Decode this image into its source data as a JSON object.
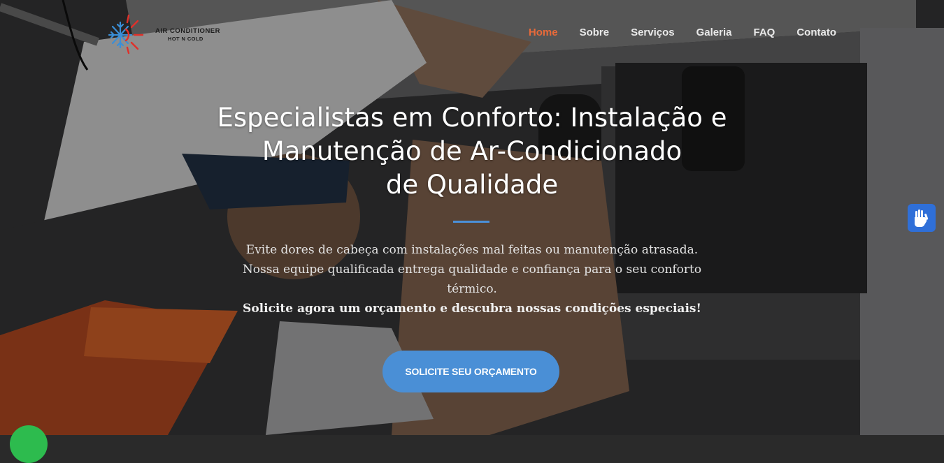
{
  "logo": {
    "line1": "AIR CONDITIONER",
    "line2": "HOT N COLD",
    "cold_color": "#3a8fd8",
    "hot_color": "#e0302a"
  },
  "nav": {
    "items": [
      {
        "label": "Home",
        "active": true
      },
      {
        "label": "Sobre",
        "active": false
      },
      {
        "label": "Serviços",
        "active": false
      },
      {
        "label": "Galeria",
        "active": false
      },
      {
        "label": "FAQ",
        "active": false
      },
      {
        "label": "Contato",
        "active": false
      }
    ],
    "active_color": "#e86a3a"
  },
  "hero": {
    "headline_lines": [
      "Especialistas em Conforto: Instalação e",
      "Manutenção de Ar-Condicionado",
      "de Qualidade"
    ],
    "description_lines": [
      "Evite dores de cabeça com instalações mal feitas ou manutenção atrasada.",
      "Nossa equipe qualificada entrega qualidade e confiança para o seu conforto",
      "térmico."
    ],
    "call_to_action_text": "Solicite agora um orçamento e descubra nossas condições especiais!",
    "cta_button": "SOLICITE SEU ORÇAMENTO",
    "accent_color": "#4a8fd6"
  },
  "widgets": {
    "accessibility_icon": "sign-language-hands-icon",
    "chat_icon": "whatsapp-icon",
    "chat_color": "#2dbb4e"
  }
}
